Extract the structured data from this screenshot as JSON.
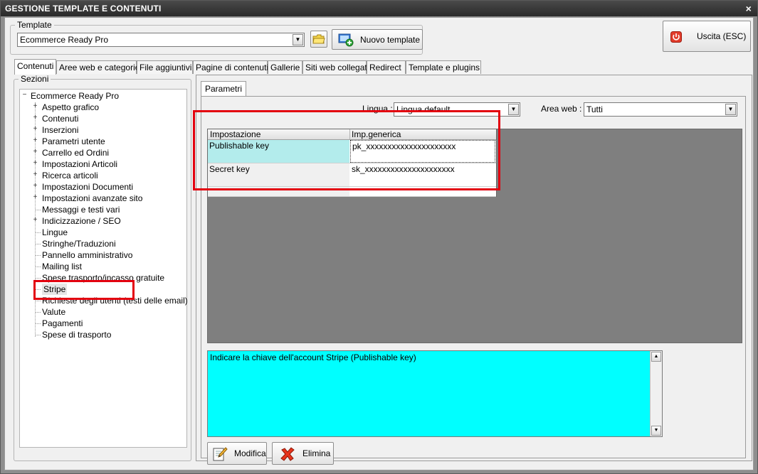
{
  "window": {
    "title": "GESTIONE TEMPLATE E CONTENUTI",
    "close_glyph": "×"
  },
  "template": {
    "group_label": "Template",
    "selected": "Ecommerce Ready Pro",
    "new_button_label": "Nuovo template"
  },
  "exit_button_label": "Uscita (ESC)",
  "tabs": [
    {
      "label": "Contenuti",
      "active": true
    },
    {
      "label": "Aree web e categorie"
    },
    {
      "label": "File aggiuntivi"
    },
    {
      "label": "Pagine di contenuti"
    },
    {
      "label": "Gallerie"
    },
    {
      "label": "Siti web collegati"
    },
    {
      "label": "Redirect"
    },
    {
      "label": "Template e plugins"
    }
  ],
  "sections": {
    "group_label": "Sezioni",
    "root": "Ecommerce Ready Pro",
    "items": [
      {
        "label": "Aspetto grafico",
        "expandable": true
      },
      {
        "label": "Contenuti",
        "expandable": true
      },
      {
        "label": "Inserzioni",
        "expandable": true
      },
      {
        "label": "Parametri utente",
        "expandable": true
      },
      {
        "label": "Carrello ed Ordini",
        "expandable": true
      },
      {
        "label": "Impostazioni Articoli",
        "expandable": true
      },
      {
        "label": "Ricerca articoli",
        "expandable": true
      },
      {
        "label": "Impostazioni Documenti",
        "expandable": true
      },
      {
        "label": "Impostazioni avanzate sito",
        "expandable": true
      },
      {
        "label": "Messaggi e testi vari",
        "expandable": false
      },
      {
        "label": "Indicizzazione / SEO",
        "expandable": true
      },
      {
        "label": "Lingue",
        "expandable": false
      },
      {
        "label": "Stringhe/Traduzioni",
        "expandable": false
      },
      {
        "label": "Pannello amministrativo",
        "expandable": false
      },
      {
        "label": "Mailing list",
        "expandable": false
      },
      {
        "label": "Spese trasporto/incasso gratuite",
        "expandable": false
      },
      {
        "label": "Stripe",
        "expandable": false,
        "selected": true
      },
      {
        "label": "Richieste degli utenti (testi delle email)",
        "expandable": false
      },
      {
        "label": "Valute",
        "expandable": false
      },
      {
        "label": "Pagamenti",
        "expandable": false
      },
      {
        "label": "Spese di trasporto",
        "expandable": false
      }
    ]
  },
  "parametri": {
    "tab_label": "Parametri",
    "lingua_label": "Lingua :",
    "lingua_value": "Lingua default",
    "area_label": "Area web :",
    "area_value": "Tutti",
    "grid": {
      "headers": [
        "Impostazione",
        "Imp.generica"
      ],
      "rows": [
        {
          "setting": "Publishable key",
          "value": "pk_xxxxxxxxxxxxxxxxxxxxx"
        },
        {
          "setting": "Secret key",
          "value": "sk_xxxxxxxxxxxxxxxxxxxxx"
        },
        {
          "setting": "",
          "value": ""
        }
      ]
    },
    "description": "Indicare la chiave dell'account Stripe (Publishable key)",
    "modify_label": "Modifica",
    "delete_label": "Elimina"
  },
  "colors": {
    "selected_cell": "#b3ecec",
    "description_bg": "#00ffff",
    "highlight": "#e3000f"
  }
}
